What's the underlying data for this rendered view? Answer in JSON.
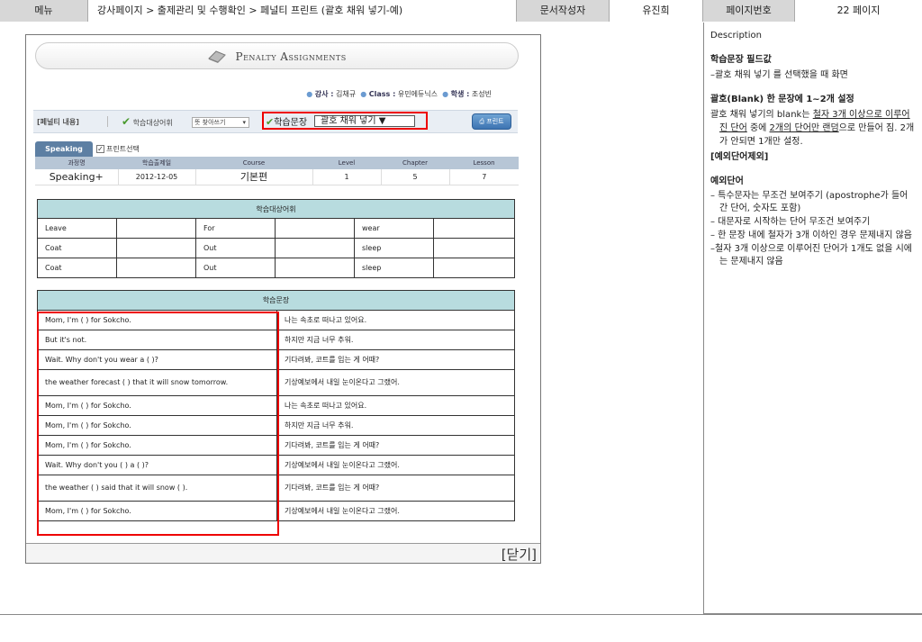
{
  "header": {
    "menu_label": "메뉴",
    "breadcrumb": "강사페이지 > 출제관리 및 수행확인 > 페널티 프린트 (괄호 채워 넣기-예)",
    "author_label": "문서작성자",
    "author_value": "유진희",
    "page_label": "페이지번호",
    "page_value": "22 페이지"
  },
  "banner": {
    "title": "Penalty Assignments"
  },
  "info": {
    "teacher_label": "강사 :",
    "teacher_value": "김채규",
    "class_label": "Class :",
    "class_value": "유민에듀닉스",
    "student_label": "학생 :",
    "student_value": "조성빈"
  },
  "filter": {
    "section_label": "[페널티 내용]",
    "vocab_label": "학습대상어휘",
    "vocab_select": "뜻 찾아쓰기",
    "sentence_label": "학습문장",
    "sentence_select": "괄호 채워 넣기 ▼",
    "print_button": "프린트"
  },
  "tabs": {
    "speaking": "Speaking",
    "print_select": "프린트선택"
  },
  "course_table": {
    "headers": [
      "과정명",
      "학습출제일",
      "Course",
      "Level",
      "Chapter",
      "Lesson"
    ],
    "row": [
      "Speaking+",
      "2012-12-05",
      "기본편",
      "1",
      "5",
      "7"
    ]
  },
  "words_table": {
    "title": "학습대상어휘",
    "rows": [
      [
        "Leave",
        "",
        "For",
        "",
        "wear",
        ""
      ],
      [
        "Coat",
        "",
        "Out",
        "",
        "sleep",
        ""
      ],
      [
        "Coat",
        "",
        "Out",
        "",
        "sleep",
        ""
      ]
    ]
  },
  "sentence_table": {
    "title": "학습문장",
    "rows": [
      [
        "Mom, I'm (                ) for Sokcho.",
        "나는 속초로 떠나고 있어요."
      ],
      [
        "But it's not.",
        "하지만 지금 너무 추워."
      ],
      [
        "Wait. Why don't you wear a (               )?",
        "기다려봐, 코트를 입는 게 어때?"
      ],
      [
        "the weather forecast (        ) that it will snow tomorrow.",
        "기상예보에서 내일 눈이온다고 그랬어."
      ],
      [
        "Mom, I'm (                ) for Sokcho.",
        "나는 속초로 떠나고 있어요."
      ],
      [
        "Mom, I'm (                ) for Sokcho.",
        "하지만 지금 너무 추워."
      ],
      [
        "Mom, I'm (                ) for Sokcho.",
        "기다려봐, 코트를 입는 게 어때?"
      ],
      [
        "Wait. Why don't you (          ) a (            )?",
        "기상예보에서 내일 눈이온다고 그랬어."
      ],
      [
        "the weather (                   ) said that it will snow (                  ).",
        "기다려봐, 코트를 입는 게 어때?"
      ],
      [
        "Mom, I'm (                ) for Sokcho.",
        "기상예보에서 내일 눈이온다고 그랬어."
      ]
    ]
  },
  "footer": {
    "close_label": "[닫기]"
  },
  "description": {
    "title": "Description",
    "s1_title": "학습문장 필드값",
    "s1_text": "–괄호 채워 넣기 를 선택했을 때 화면",
    "s2_title": "괄호(Blank) 한 문장에 1~2개 설정",
    "s2_text_a": "괄호 채워 넣기의 blank는 ",
    "s2_text_u1": "철자 3개 이상으로 이루어진 단어",
    "s2_text_b": " 중에 ",
    "s2_text_u2": "2개의 단어만 랜덤",
    "s2_text_c": "으로 만들어 짐. 2개가 안되면 1개만 설정.",
    "s2_note": "[예외단어제외]",
    "s3_title": "예외단어",
    "bullets": [
      "– 특수문자는 무조건 보여주기 (apostrophe가 들어간 단어, 숫자도 포함)",
      "– 대문자로 시작하는 단어 무조건 보여주기",
      "– 한 문장 내에 철자가 3개 이하인 경우 문제내지 않음",
      "–철자 3개 이상으로 이루어진 단어가 1개도 없을 시에는 문제내지 않음"
    ]
  }
}
